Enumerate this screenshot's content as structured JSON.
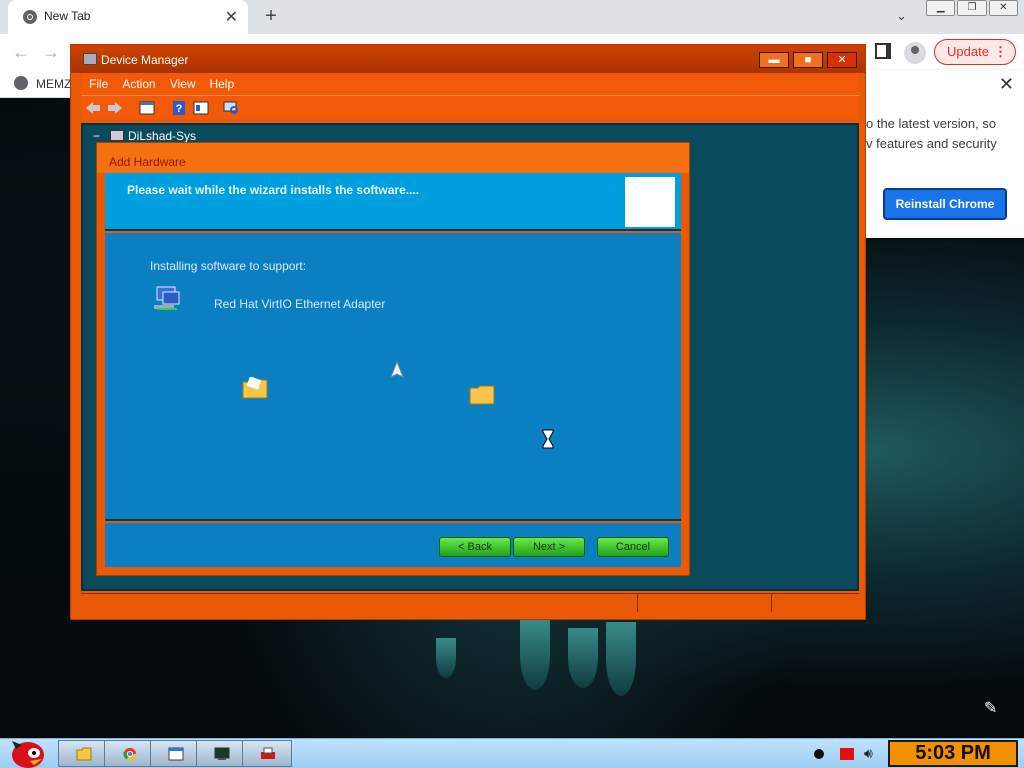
{
  "browser": {
    "tab_title": "New Tab",
    "tab_close": "✕",
    "new_tab": "+",
    "update_label": "Update",
    "bookmark_label": "MEMZ",
    "win_ctrls": [
      "▁",
      "❐",
      "✕"
    ]
  },
  "update_panel": {
    "text_line1": "o the latest version, so",
    "text_line2": "v features and security",
    "reinstall_label": "Reinstall Chrome",
    "close": "✕"
  },
  "device_manager": {
    "title": "Device Manager",
    "menu": [
      "File",
      "Action",
      "View",
      "Help"
    ],
    "tree_root": "DiLshad-Sys",
    "ctrl_minimize": "▬",
    "ctrl_maximize": "■",
    "ctrl_close": "✕"
  },
  "wizard": {
    "title": "Add Hardware",
    "header_text": "Please wait while the wizard installs the software....",
    "installing_label": "Installing software to support:",
    "device_name": "Red Hat VirtIO Ethernet Adapter",
    "back_label": "< Back",
    "next_label": "Next >",
    "cancel_label": "Cancel"
  },
  "taskbar": {
    "clock": "5:03 PM",
    "items": [
      "explorer-icon",
      "chrome-icon",
      "window-icon",
      "terminal-icon",
      "printer-icon"
    ]
  },
  "colors": {
    "window_orange": "#e85a08",
    "wizard_blue": "#0a7fc2",
    "header_blue": "#00a0e0",
    "button_green": "#1ea21a",
    "chrome_blue": "#1a73e8"
  }
}
